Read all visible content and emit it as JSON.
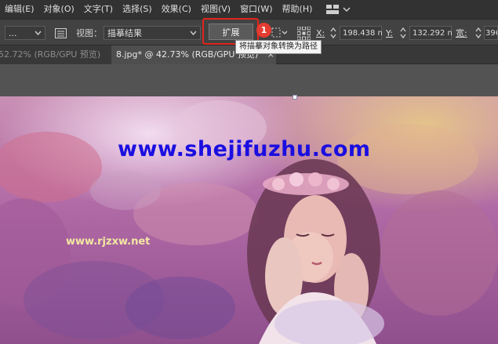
{
  "menu": {
    "items": [
      "编辑(E)",
      "对象(O)",
      "文字(T)",
      "选择(S)",
      "效果(C)",
      "视图(V)",
      "窗口(W)",
      "帮助(H)"
    ]
  },
  "toolbar": {
    "preset_value": "...",
    "view_label": "视图：",
    "view_value": "描摹结果",
    "expand_label": "扩展",
    "x_label": "X:",
    "x_value": "198.438 n",
    "y_label": "Y:",
    "y_value": "132.292 n",
    "w_label": "宽:",
    "w_value": "396"
  },
  "annotation": {
    "badge": "1",
    "tooltip": "将描摹对象转换为路径"
  },
  "tabs": [
    {
      "label": "52.72% (RGB/GPU 预览)",
      "active": false
    },
    {
      "label": "8.jpg* @ 42.73% (RGB/GPU 预览)",
      "active": true
    }
  ],
  "tab_close": "×",
  "canvas": {
    "watermark_main": "www.shejifuzhu.com",
    "watermark_small": "www.rjzxw.net"
  },
  "colors": {
    "highlight_red": "#e0251b",
    "badge_red": "#e53b30",
    "watermark_blue": "#1a0ee0"
  }
}
